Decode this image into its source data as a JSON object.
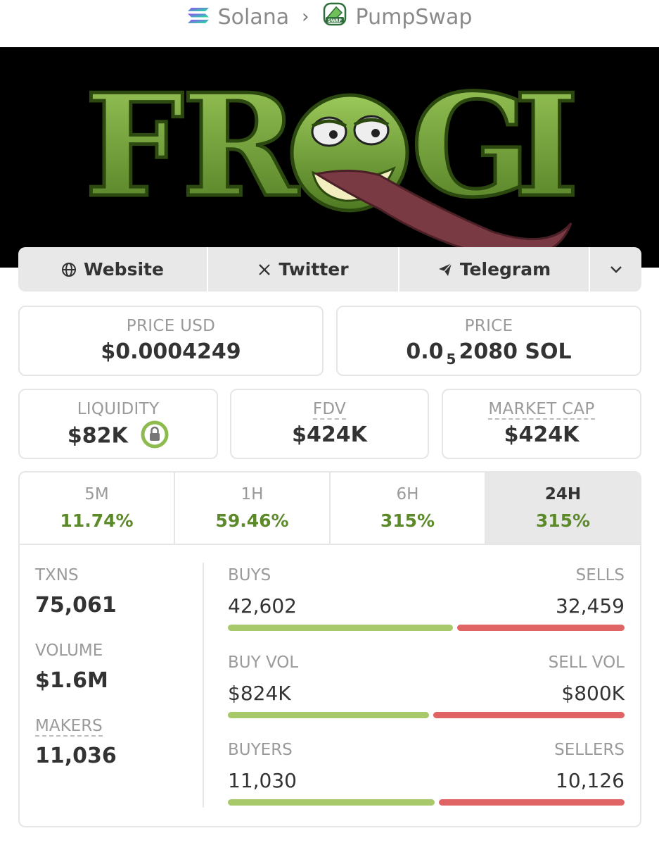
{
  "breadcrumb": {
    "chain": "Solana",
    "dex": "PumpSwap"
  },
  "banner": {
    "logo_text": "FROGI"
  },
  "socials": [
    {
      "label": "Website",
      "icon": "globe-icon"
    },
    {
      "label": "Twitter",
      "icon": "x-icon"
    },
    {
      "label": "Telegram",
      "icon": "telegram-icon"
    }
  ],
  "stats": {
    "price_usd": {
      "label": "PRICE USD",
      "value": "$0.0004249"
    },
    "price": {
      "label": "PRICE",
      "prefix": "0.0",
      "sub": "5",
      "suffix": "2080 SOL"
    },
    "liquidity": {
      "label": "LIQUIDITY",
      "value": "$82K"
    },
    "fdv": {
      "label": "FDV",
      "value": "$424K"
    },
    "market_cap": {
      "label": "MARKET CAP",
      "value": "$424K"
    }
  },
  "timeframes": [
    {
      "label": "5M",
      "change": "11.74%"
    },
    {
      "label": "1H",
      "change": "59.46%"
    },
    {
      "label": "6H",
      "change": "315%"
    },
    {
      "label": "24H",
      "change": "315%"
    }
  ],
  "metrics": {
    "txns": {
      "label": "TXNS",
      "value": "75,061"
    },
    "volume": {
      "label": "VOLUME",
      "value": "$1.6M"
    },
    "makers": {
      "label": "MAKERS",
      "value": "11,036"
    }
  },
  "splits": [
    {
      "left_label": "BUYS",
      "left_value": "42,602",
      "right_label": "SELLS",
      "right_value": "32,459",
      "buy_share": 0.5676
    },
    {
      "left_label": "BUY VOL",
      "left_value": "$824K",
      "right_label": "SELL VOL",
      "right_value": "$800K",
      "buy_share": 0.5074
    },
    {
      "left_label": "BUYERS",
      "left_value": "11,030",
      "right_label": "SELLERS",
      "right_value": "10,126",
      "buy_share": 0.5214
    }
  ],
  "colors": {
    "positive": "#5c8a2a",
    "buy_bar": "#a8c96a",
    "sell_bar": "#e06464",
    "frog_green": "#7aa83a"
  }
}
